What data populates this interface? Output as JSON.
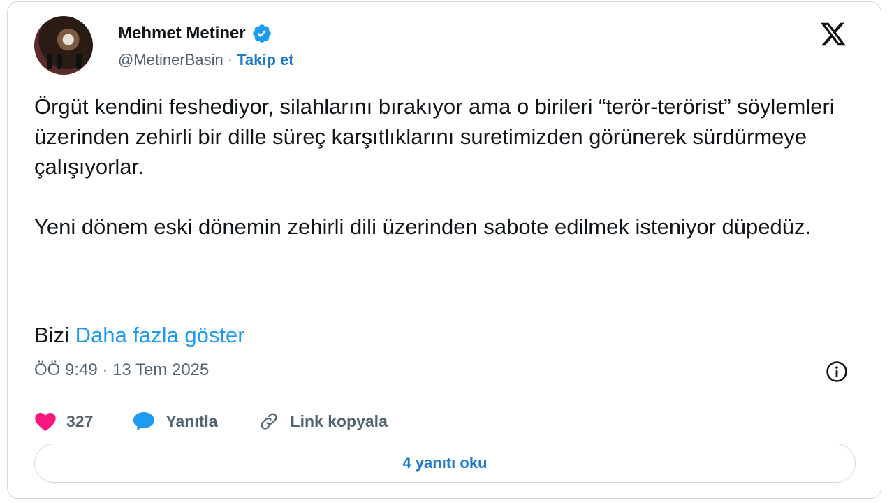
{
  "author": {
    "name": "Mehmet Metiner",
    "handle": "@MetinerBasin",
    "separator": "·",
    "follow_label": "Takip et",
    "verified": true
  },
  "icons": {
    "verified": "verified-badge-icon",
    "platform": "x-logo-icon",
    "info": "info-icon",
    "like": "heart-icon",
    "reply": "speech-bubble-icon",
    "copy_link": "link-icon"
  },
  "tweet": {
    "paragraphs": [
      "Örgüt kendini feshediyor, silahlarını bırakıyor ama o birileri “terör-terörist” söylemleri üzerinden zehirli bir dille süreç karşıtlıklarını suretimizden görünerek sürdürmeye çalışıyorlar.",
      "Yeni dönem eski dönemin zehirli dili üzerinden sabote edilmek isteniyor düpedüz."
    ],
    "truncated_text": "Bizi",
    "show_more_label": "Daha fazla göster",
    "timestamp": "ÖÖ 9:49 · 13 Tem 2025"
  },
  "actions": {
    "like_count": "327",
    "reply_label": "Yanıtla",
    "copy_link_label": "Link kopyala"
  },
  "read_replies_label": "4 yanıtı oku",
  "colors": {
    "link_blue": "#1d9bf0",
    "follow_blue": "#1d7bc9",
    "like_pink": "#f91880",
    "secondary_text": "#536471",
    "border": "#cfd9de"
  }
}
